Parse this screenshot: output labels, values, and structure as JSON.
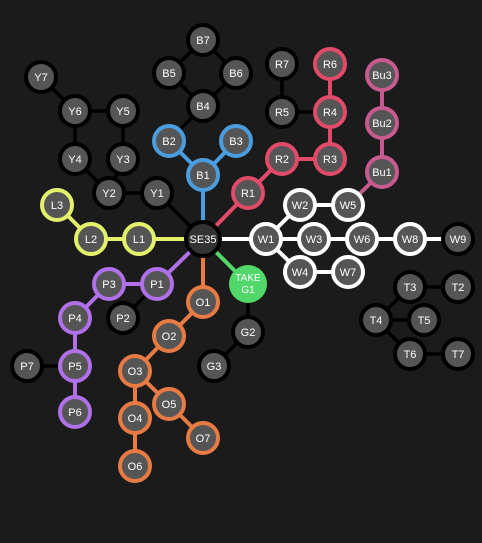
{
  "colors": {
    "background": "#1b1b1b",
    "node_fill": "#555555",
    "node_stroke_default": "#000000",
    "edge_default": "#000000",
    "label": "#ffffff",
    "blue": "#4a9ee0",
    "red": "#e24a6a",
    "pink": "#c75a8f",
    "white": "#ffffff",
    "yellow": "#e3f26a",
    "purple": "#b070e8",
    "orange": "#e87a44",
    "green": "#52d86a",
    "hub_fill": "#333333"
  },
  "nodes": [
    {
      "id": "SE35",
      "label": "SE35",
      "color": "black"
    },
    {
      "id": "B7",
      "label": "B7",
      "color": "black"
    },
    {
      "id": "B5",
      "label": "B5",
      "color": "black"
    },
    {
      "id": "B6",
      "label": "B6",
      "color": "black"
    },
    {
      "id": "B4",
      "label": "B4",
      "color": "black"
    },
    {
      "id": "B2",
      "label": "B2",
      "color": "blue"
    },
    {
      "id": "B3",
      "label": "B3",
      "color": "blue"
    },
    {
      "id": "B1",
      "label": "B1",
      "color": "blue"
    },
    {
      "id": "R7",
      "label": "R7",
      "color": "black"
    },
    {
      "id": "R5",
      "label": "R5",
      "color": "black"
    },
    {
      "id": "R6",
      "label": "R6",
      "color": "red"
    },
    {
      "id": "R4",
      "label": "R4",
      "color": "red"
    },
    {
      "id": "R3",
      "label": "R3",
      "color": "red"
    },
    {
      "id": "R2",
      "label": "R2",
      "color": "red"
    },
    {
      "id": "R1",
      "label": "R1",
      "color": "red"
    },
    {
      "id": "Bu3",
      "label": "Bu3",
      "color": "pink"
    },
    {
      "id": "Bu2",
      "label": "Bu2",
      "color": "pink"
    },
    {
      "id": "Bu1",
      "label": "Bu1",
      "color": "pink"
    },
    {
      "id": "Y7",
      "label": "Y7",
      "color": "black"
    },
    {
      "id": "Y6",
      "label": "Y6",
      "color": "black"
    },
    {
      "id": "Y5",
      "label": "Y5",
      "color": "black"
    },
    {
      "id": "Y4",
      "label": "Y4",
      "color": "black"
    },
    {
      "id": "Y3",
      "label": "Y3",
      "color": "black"
    },
    {
      "id": "Y2",
      "label": "Y2",
      "color": "black"
    },
    {
      "id": "Y1",
      "label": "Y1",
      "color": "black"
    },
    {
      "id": "L3",
      "label": "L3",
      "color": "yellow"
    },
    {
      "id": "L2",
      "label": "L2",
      "color": "yellow"
    },
    {
      "id": "L1",
      "label": "L1",
      "color": "yellow"
    },
    {
      "id": "W1",
      "label": "W1",
      "color": "white"
    },
    {
      "id": "W2",
      "label": "W2",
      "color": "white"
    },
    {
      "id": "W5",
      "label": "W5",
      "color": "white"
    },
    {
      "id": "W3",
      "label": "W3",
      "color": "white"
    },
    {
      "id": "W6",
      "label": "W6",
      "color": "white"
    },
    {
      "id": "W8",
      "label": "W8",
      "color": "white"
    },
    {
      "id": "W9",
      "label": "W9",
      "color": "black"
    },
    {
      "id": "W4",
      "label": "W4",
      "color": "white"
    },
    {
      "id": "W7",
      "label": "W7",
      "color": "white"
    },
    {
      "id": "TAKE",
      "label": "TAKE",
      "label2": "G1",
      "color": "green"
    },
    {
      "id": "G2",
      "label": "G2",
      "color": "black"
    },
    {
      "id": "G3",
      "label": "G3",
      "color": "black"
    },
    {
      "id": "P1",
      "label": "P1",
      "color": "purple"
    },
    {
      "id": "P2",
      "label": "P2",
      "color": "black"
    },
    {
      "id": "P3",
      "label": "P3",
      "color": "purple"
    },
    {
      "id": "P4",
      "label": "P4",
      "color": "purple"
    },
    {
      "id": "P5",
      "label": "P5",
      "color": "purple"
    },
    {
      "id": "P6",
      "label": "P6",
      "color": "purple"
    },
    {
      "id": "P7",
      "label": "P7",
      "color": "black"
    },
    {
      "id": "O1",
      "label": "O1",
      "color": "orange"
    },
    {
      "id": "O2",
      "label": "O2",
      "color": "orange"
    },
    {
      "id": "O3",
      "label": "O3",
      "color": "orange"
    },
    {
      "id": "O4",
      "label": "O4",
      "color": "orange"
    },
    {
      "id": "O5",
      "label": "O5",
      "color": "orange"
    },
    {
      "id": "O6",
      "label": "O6",
      "color": "orange"
    },
    {
      "id": "O7",
      "label": "O7",
      "color": "orange"
    },
    {
      "id": "T2",
      "label": "T2",
      "color": "black"
    },
    {
      "id": "T3",
      "label": "T3",
      "color": "black"
    },
    {
      "id": "T4",
      "label": "T4",
      "color": "black"
    },
    {
      "id": "T5",
      "label": "T5",
      "color": "black"
    },
    {
      "id": "T6",
      "label": "T6",
      "color": "black"
    },
    {
      "id": "T7",
      "label": "T7",
      "color": "black"
    }
  ],
  "edges": [
    [
      "B7",
      "B5",
      "black"
    ],
    [
      "B7",
      "B6",
      "black"
    ],
    [
      "B5",
      "B4",
      "black"
    ],
    [
      "B6",
      "B4",
      "black"
    ],
    [
      "B4",
      "B2",
      "black"
    ],
    [
      "B2",
      "B1",
      "blue"
    ],
    [
      "B3",
      "B1",
      "blue"
    ],
    [
      "B1",
      "SE35",
      "blue"
    ],
    [
      "R7",
      "R5",
      "black"
    ],
    [
      "R5",
      "R4",
      "black"
    ],
    [
      "R6",
      "R4",
      "red"
    ],
    [
      "R4",
      "R3",
      "red"
    ],
    [
      "R3",
      "R2",
      "red"
    ],
    [
      "R2",
      "R1",
      "red"
    ],
    [
      "R1",
      "SE35",
      "red"
    ],
    [
      "Bu3",
      "Bu2",
      "pink"
    ],
    [
      "Bu2",
      "Bu1",
      "pink"
    ],
    [
      "Bu1",
      "W5",
      "pink"
    ],
    [
      "Y7",
      "Y6",
      "black"
    ],
    [
      "Y6",
      "Y5",
      "black"
    ],
    [
      "Y6",
      "Y4",
      "black"
    ],
    [
      "Y5",
      "Y3",
      "black"
    ],
    [
      "Y4",
      "Y2",
      "black"
    ],
    [
      "Y3",
      "Y2",
      "black"
    ],
    [
      "Y2",
      "Y1",
      "black"
    ],
    [
      "Y1",
      "SE35",
      "black"
    ],
    [
      "L3",
      "L2",
      "yellow"
    ],
    [
      "L2",
      "L1",
      "yellow"
    ],
    [
      "L1",
      "SE35",
      "yellow"
    ],
    [
      "SE35",
      "W1",
      "white"
    ],
    [
      "W1",
      "W2",
      "white"
    ],
    [
      "W2",
      "W5",
      "white"
    ],
    [
      "W1",
      "W3",
      "white"
    ],
    [
      "W3",
      "W6",
      "white"
    ],
    [
      "W6",
      "W8",
      "white"
    ],
    [
      "W8",
      "W9",
      "white"
    ],
    [
      "W1",
      "W4",
      "white"
    ],
    [
      "W4",
      "W7",
      "white"
    ],
    [
      "SE35",
      "TAKE",
      "green"
    ],
    [
      "TAKE",
      "G2",
      "black"
    ],
    [
      "G2",
      "G3",
      "black"
    ],
    [
      "SE35",
      "P1",
      "purple"
    ],
    [
      "P1",
      "P3",
      "purple"
    ],
    [
      "P1",
      "P2",
      "black"
    ],
    [
      "P3",
      "P4",
      "purple"
    ],
    [
      "P4",
      "P5",
      "purple"
    ],
    [
      "P5",
      "P6",
      "purple"
    ],
    [
      "P5",
      "P7",
      "black"
    ],
    [
      "SE35",
      "O1",
      "orange"
    ],
    [
      "O1",
      "O2",
      "orange"
    ],
    [
      "O2",
      "O3",
      "orange"
    ],
    [
      "O3",
      "O4",
      "orange"
    ],
    [
      "O4",
      "O6",
      "orange"
    ],
    [
      "O3",
      "O5",
      "orange"
    ],
    [
      "O5",
      "O7",
      "orange"
    ],
    [
      "T3",
      "T2",
      "black"
    ],
    [
      "T3",
      "T4",
      "black"
    ],
    [
      "T4",
      "T5",
      "black"
    ],
    [
      "T4",
      "T6",
      "black"
    ],
    [
      "T6",
      "T7",
      "black"
    ]
  ]
}
